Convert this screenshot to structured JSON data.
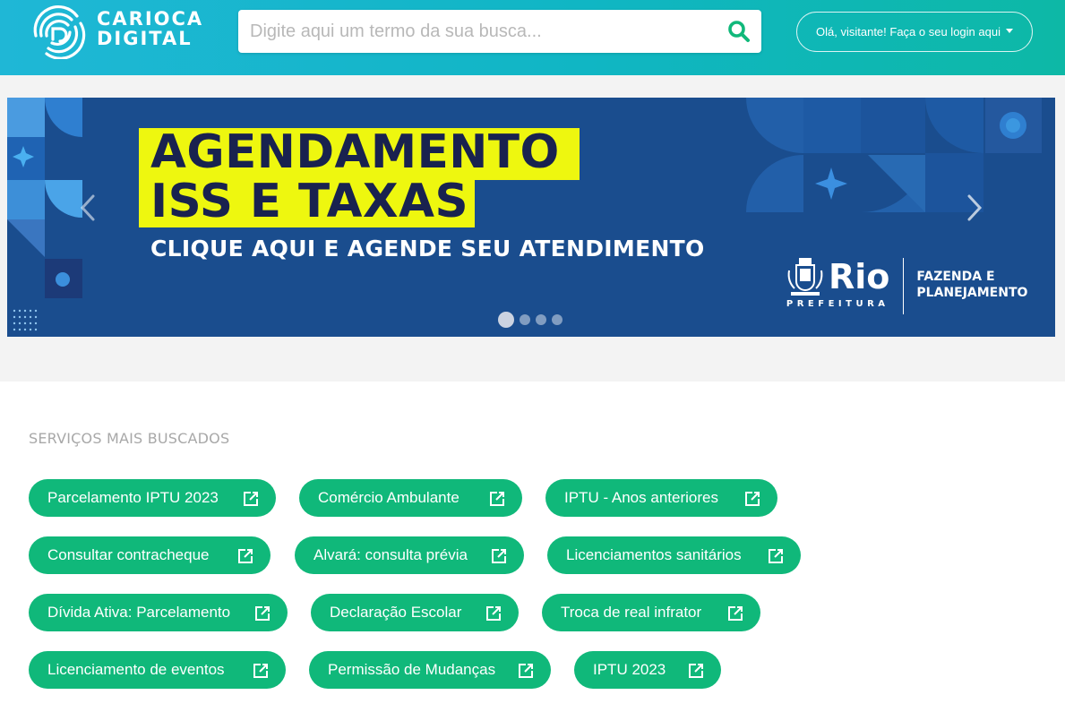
{
  "header": {
    "logo_line1": "CARIOCA",
    "logo_line2": "DIGITAL",
    "search_placeholder": "Digite aqui um termo da sua busca...",
    "login_label": "Olá, visitante! Faça o seu login aqui"
  },
  "banner": {
    "headline_line1": "AGENDAMENTO",
    "headline_line2": "ISS E TAXAS",
    "subline": "CLIQUE AQUI E AGENDE SEU ATENDIMENTO",
    "brand_name": "Rio",
    "brand_sub": "PREFEITURA",
    "dept_line1": "FAZENDA E",
    "dept_line2": "PLANEJAMENTO",
    "slides_total": 4,
    "active_slide": 1
  },
  "services": {
    "title": "SERVIÇOS MAIS BUSCADOS",
    "items": [
      "Parcelamento IPTU 2023",
      "Comércio Ambulante",
      "IPTU - Anos anteriores",
      "Consultar contracheque",
      "Alvará: consulta prévia",
      "Licenciamentos sanitários",
      "Dívida Ativa: Parcelamento",
      "Declaração Escolar",
      "Troca de real infrator",
      "Licenciamento de eventos",
      "Permissão de Mudanças",
      "IPTU 2023"
    ]
  },
  "colors": {
    "header_start": "#1fb7d6",
    "header_end": "#0db8a6",
    "pill": "#10b87a",
    "banner_bg": "#1a4d8e",
    "highlight": "#eef70f",
    "headline_text": "#19224f",
    "search_icon": "#10b87a"
  },
  "icons": {
    "logo": "fingerprint-d-icon",
    "search": "search-icon",
    "external": "external-link-icon",
    "prev": "chevron-left-icon",
    "next": "chevron-right-icon",
    "crest": "rio-coat-of-arms-icon"
  }
}
